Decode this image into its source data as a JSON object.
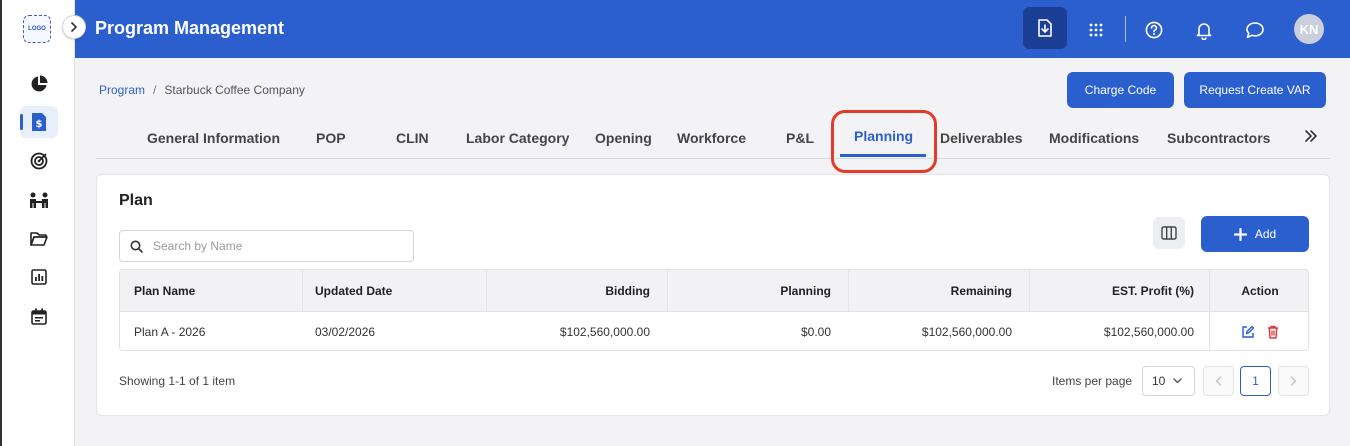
{
  "app": {
    "logo_text": "LOGO",
    "title": "Program Management",
    "avatar_initials": "KN"
  },
  "colors": {
    "primary": "#2b5fce",
    "highlight_ring": "#e23b28",
    "delete": "#e03a3a"
  },
  "sidebar": {
    "items": [
      {
        "icon": "pie-chart-icon",
        "active": false
      },
      {
        "icon": "dollar-document-icon",
        "active": true
      },
      {
        "icon": "target-icon",
        "active": false
      },
      {
        "icon": "people-icon",
        "active": false
      },
      {
        "icon": "folder-icon",
        "active": false
      },
      {
        "icon": "bar-chart-icon",
        "active": false
      },
      {
        "icon": "calendar-icon",
        "active": false
      }
    ]
  },
  "header_icons": [
    "download-icon",
    "apps-grid-icon",
    "help-icon",
    "bell-icon",
    "chat-icon"
  ],
  "breadcrumb": {
    "root": "Program",
    "separator": "/",
    "current": "Starbuck Coffee Company"
  },
  "actions": {
    "charge_code": "Charge Code",
    "request_create_var": "Request Create VAR"
  },
  "tabs": [
    {
      "label": "General Information",
      "active": false
    },
    {
      "label": "POP",
      "active": false
    },
    {
      "label": "CLIN",
      "active": false
    },
    {
      "label": "Labor Category",
      "active": false
    },
    {
      "label": "Opening",
      "active": false
    },
    {
      "label": "Workforce",
      "active": false
    },
    {
      "label": "P&L",
      "active": false
    },
    {
      "label": "Planning",
      "active": true
    },
    {
      "label": "Deliverables",
      "active": false
    },
    {
      "label": "Modifications",
      "active": false
    },
    {
      "label": "Subcontractors",
      "active": false
    }
  ],
  "plan": {
    "title": "Plan",
    "search_placeholder": "Search by Name",
    "add_label": "Add",
    "columns": [
      "Plan Name",
      "Updated Date",
      "Bidding",
      "Planning",
      "Remaining",
      "EST. Profit (%)",
      "Action"
    ],
    "rows": [
      {
        "plan_name": "Plan A - 2026",
        "updated_date": "03/02/2026",
        "bidding": "$102,560,000.00",
        "planning": "$0.00",
        "remaining": "$102,560,000.00",
        "est_profit": "$102,560,000.00"
      }
    ],
    "showing_text": "Showing 1-1 of 1 item",
    "items_per_page_label": "Items per page",
    "items_per_page_value": "10",
    "current_page": "1"
  }
}
